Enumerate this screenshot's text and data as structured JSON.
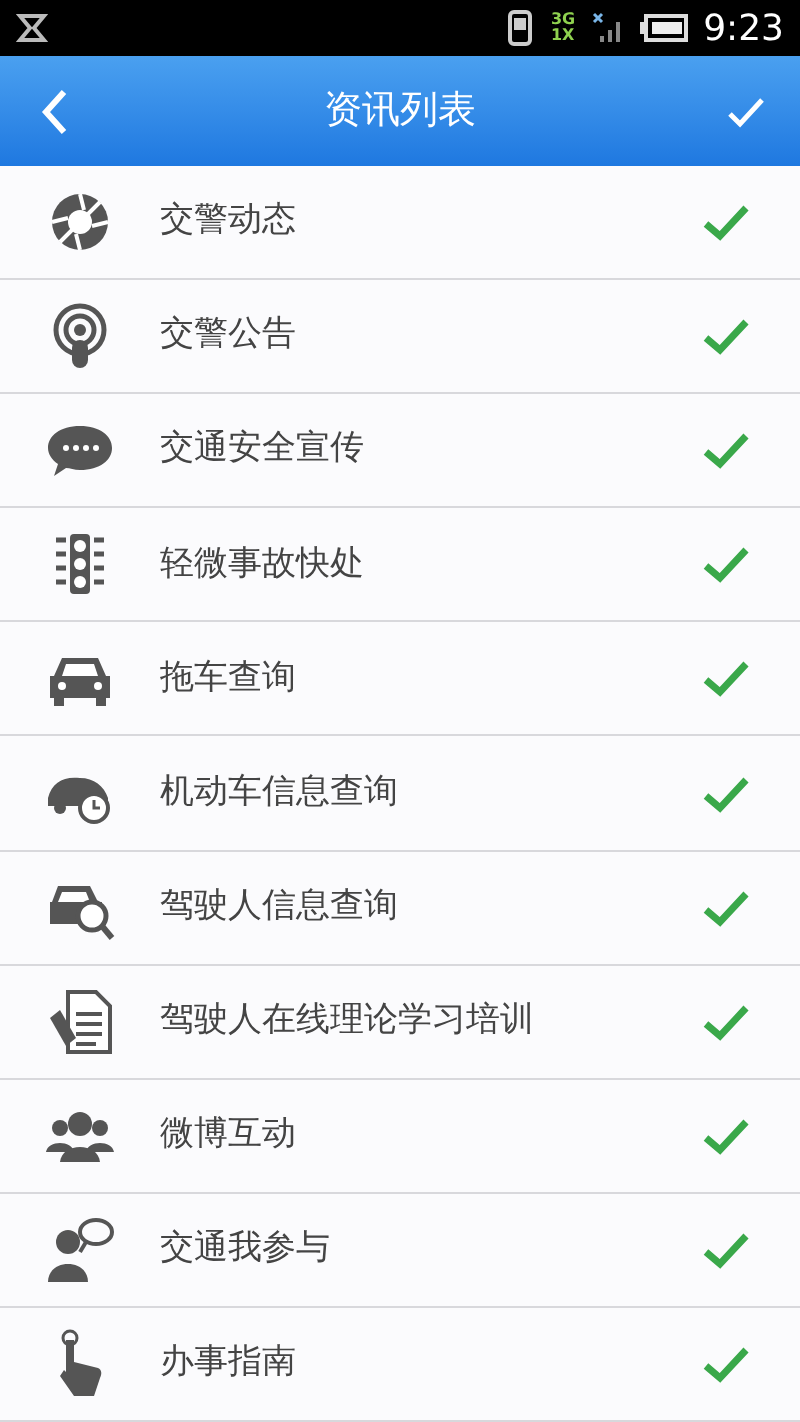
{
  "status_bar": {
    "network_top": "3G",
    "network_bottom": "1X",
    "time": "9:23"
  },
  "header": {
    "title": "资讯列表"
  },
  "items": [
    {
      "label": "交警动态",
      "kind": "aperture",
      "checked": true
    },
    {
      "label": "交警公告",
      "kind": "broadcast",
      "checked": true
    },
    {
      "label": "交通安全宣传",
      "kind": "chat",
      "checked": true
    },
    {
      "label": "轻微事故快处",
      "kind": "traffic-light",
      "checked": true
    },
    {
      "label": "拖车查询",
      "kind": "car",
      "checked": true
    },
    {
      "label": "机动车信息查询",
      "kind": "car-clock",
      "checked": true
    },
    {
      "label": "驾驶人信息查询",
      "kind": "car-search",
      "checked": true
    },
    {
      "label": "驾驶人在线理论学习培训",
      "kind": "document",
      "checked": true
    },
    {
      "label": "微博互动",
      "kind": "group",
      "checked": true
    },
    {
      "label": "交通我参与",
      "kind": "person-chat",
      "checked": true
    },
    {
      "label": "办事指南",
      "kind": "hand",
      "checked": true
    }
  ]
}
